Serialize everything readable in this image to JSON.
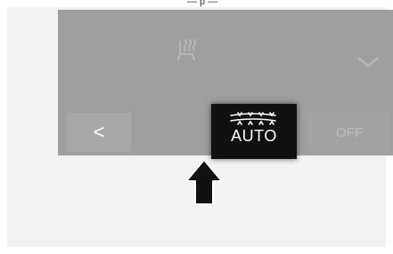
{
  "top_label": "— p —",
  "controls": {
    "back_label": "<",
    "auto_label": "AUTO",
    "off_label": "OFF"
  },
  "icons": {
    "seat": "seat-heat-icon",
    "dropdown": "chevron-down-icon",
    "auto_glyph": "auto-defrost-glyph-icon",
    "pointer": "up-arrow-pointer-icon"
  }
}
